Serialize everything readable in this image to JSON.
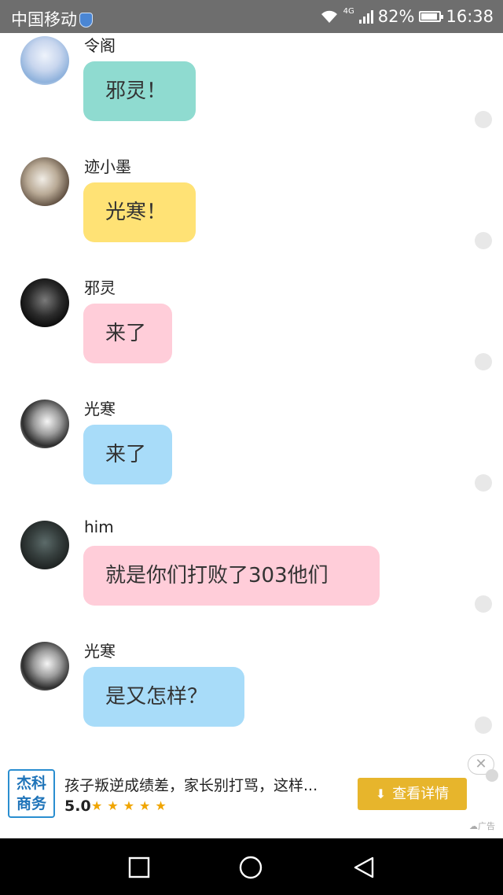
{
  "status_bar": {
    "carrier": "中国移动",
    "network": "4G",
    "battery": "82%",
    "time": "16:38"
  },
  "messages": [
    {
      "sender": "令阁",
      "text": "邪灵！",
      "bubble_color": "#8fdbd0",
      "avatar": "令阁-avatar"
    },
    {
      "sender": "迹小墨",
      "text": "光寒！",
      "bubble_color": "#ffe275",
      "avatar": "迹小墨-avatar"
    },
    {
      "sender": "邪灵",
      "text": "来了",
      "bubble_color": "#ffcdd9",
      "avatar": "邪灵-avatar"
    },
    {
      "sender": "光寒",
      "text": "来了",
      "bubble_color": "#a8dcf9",
      "avatar": "光寒-avatar"
    },
    {
      "sender": "him",
      "text": "就是你们打败了303他们",
      "bubble_color": "#ffcdd9",
      "avatar": "him-avatar"
    },
    {
      "sender": "光寒",
      "text": "是又怎样？",
      "bubble_color": "#a8dcf9",
      "avatar": "光寒-avatar"
    }
  ],
  "ad": {
    "logo_line1": "杰科",
    "logo_line2": "商务",
    "title": "孩子叛逆成绩差，家长别打骂，这样...",
    "rating": "5.0",
    "stars": "★★★★★",
    "button_label": "查看详情",
    "close_symbol": "✕",
    "ad_tag": "广告"
  },
  "nav": {
    "recents": "square-icon",
    "home": "circle-icon",
    "back": "triangle-back-icon"
  }
}
